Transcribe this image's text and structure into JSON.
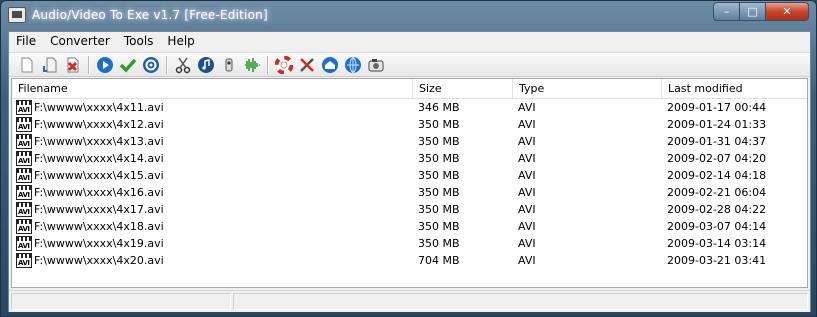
{
  "window": {
    "title": "Audio/Video To Exe v1.7 [Free-Edition]",
    "controls": {
      "minimize": "–",
      "maximize": "□",
      "close": "✕"
    }
  },
  "menu": [
    "File",
    "Converter",
    "Tools",
    "Help"
  ],
  "toolbar": {
    "groups": [
      [
        "new-icon",
        "add-file-icon",
        "delete-icon"
      ],
      [
        "play-icon",
        "check-icon",
        "settings-icon"
      ],
      [
        "cut-icon",
        "music-icon",
        "camera-icon",
        "waveform-icon"
      ],
      [
        "help-lifebuoy-icon",
        "tools-icon",
        "home-icon",
        "web-icon",
        "about-icon"
      ]
    ]
  },
  "list": {
    "columns": {
      "filename": "Filename",
      "size": "Size",
      "type": "Type",
      "modified": "Last modified"
    },
    "icon_label": "AVI",
    "rows": [
      {
        "filename": "F:\\wwww\\xxxx\\4x11.avi",
        "size": "346 MB",
        "type": "AVI",
        "modified": "2009-01-17 00:44"
      },
      {
        "filename": "F:\\wwww\\xxxx\\4x12.avi",
        "size": "350 MB",
        "type": "AVI",
        "modified": "2009-01-24 01:33"
      },
      {
        "filename": "F:\\wwww\\xxxx\\4x13.avi",
        "size": "350 MB",
        "type": "AVI",
        "modified": "2009-01-31 04:37"
      },
      {
        "filename": "F:\\wwww\\xxxx\\4x14.avi",
        "size": "350 MB",
        "type": "AVI",
        "modified": "2009-02-07 04:20"
      },
      {
        "filename": "F:\\wwww\\xxxx\\4x15.avi",
        "size": "350 MB",
        "type": "AVI",
        "modified": "2009-02-14 04:18"
      },
      {
        "filename": "F:\\wwww\\xxxx\\4x16.avi",
        "size": "350 MB",
        "type": "AVI",
        "modified": "2009-02-21 06:04"
      },
      {
        "filename": "F:\\wwww\\xxxx\\4x17.avi",
        "size": "350 MB",
        "type": "AVI",
        "modified": "2009-02-28 04:22"
      },
      {
        "filename": "F:\\wwww\\xxxx\\4x18.avi",
        "size": "350 MB",
        "type": "AVI",
        "modified": "2009-03-07 04:14"
      },
      {
        "filename": "F:\\wwww\\xxxx\\4x19.avi",
        "size": "350 MB",
        "type": "AVI",
        "modified": "2009-03-14 03:14"
      },
      {
        "filename": "F:\\wwww\\xxxx\\4x20.avi",
        "size": "704 MB",
        "type": "AVI",
        "modified": "2009-03-21 03:41"
      }
    ]
  },
  "colors": {
    "accent_blue": "#1d6fc9",
    "check_green": "#2e9e2e",
    "delete_red": "#d42a1e"
  }
}
